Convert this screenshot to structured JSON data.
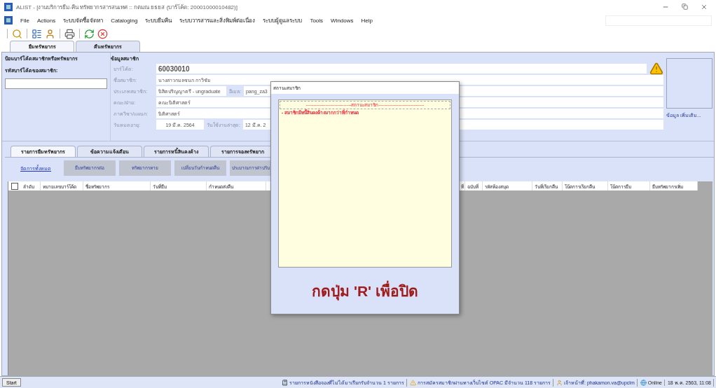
{
  "window": {
    "title": "ALIST - [งานบริการยืม-คืน ทรัพยากรสารสนเทศ :: กตมณ ยธยส (บาร์โค้ด: 20001000010482)]"
  },
  "menu": [
    "File",
    "Actions",
    "ระบบจัดซื้อจัดหา",
    "Cataloging",
    "ระบบยืมคืน",
    "ระบบวารสารและสิ่งพิมพ์ต่อเนื่อง",
    "ระบบผู้ดูแลระบบ",
    "Tools",
    "Windows",
    "Help"
  ],
  "main_tabs": [
    {
      "label": "ยืมทรัพยากร",
      "selected": true
    },
    {
      "label": "คืนทรัพยากร",
      "selected": false
    }
  ],
  "barcode_panel": {
    "title": "ป้อนบาร์โค้ดสมาชิกหรือทรัพยากร",
    "label": "รหัสบาร์โค้ดของสมาชิก:"
  },
  "member_info": {
    "title": "ข้อมูลสมาชิก",
    "rows": [
      {
        "fields": [
          {
            "label": "บาร์โค้ด:",
            "value": "60030010",
            "kind": "large"
          }
        ]
      },
      {
        "fields": [
          {
            "label": "ชื่อสมาชิก:",
            "value": "นางสาวกมลชนก กาวิชัย",
            "kind": "normal"
          }
        ]
      },
      {
        "fields": [
          {
            "label": "ประเภทสมาชิก:",
            "value": "นิสิตปริญญาตรี - ungraduate",
            "kind": "short"
          },
          {
            "label": "อีเมล:",
            "value": "pang_za3",
            "kind": "normal"
          }
        ]
      },
      {
        "fields": [
          {
            "label": "คณะ/ฝ่าย:",
            "value": "คณะนิติศาสตร์",
            "kind": "normal"
          }
        ]
      },
      {
        "fields": [
          {
            "label": "ภาควิชา/แผนก:",
            "value": "นิติศาสตร์",
            "kind": "normal"
          }
        ]
      },
      {
        "fields": [
          {
            "label": "วันหมดอายุ:",
            "value": "19 มี.ค. 2564",
            "kind": "date"
          },
          {
            "label": "วันใช้งานล่าสุด:",
            "value": "12 มี.ค. 2",
            "kind": "normal"
          }
        ]
      }
    ],
    "more_link": "ข้อมูล เพิ่มเติม..."
  },
  "sub_tabs": [
    {
      "label": "รายการยืมทรัพยากร",
      "selected": true
    },
    {
      "label": "ข้อความแจ้งเตือน",
      "selected": false
    },
    {
      "label": "รายการหนี้สินคงค้าง",
      "selected": false
    },
    {
      "label": "รายการจองทรัพยาก",
      "selected": false
    }
  ],
  "manage_link": "จัดการทั้งหมด",
  "action_buttons": [
    "ยืมทรัพยากรต่อ",
    "ทรัพยากรหาย",
    "เปลี่ยนวันกำหนดคืน",
    "ประมาณการค่าปรับ"
  ],
  "table": {
    "select_all_checked": false,
    "columns_left": [
      "ลำดับ",
      "หมายเลขบาร์โค้ด",
      "ชื่อทรัพยากร",
      "วันที่ยืม",
      "กำหนดส่งคืน"
    ],
    "columns_right": [
      "ที่",
      "ฉบับที่",
      "รหัสห้องสมุด",
      "วันที่เรียกคืน",
      "โน้ตการเรียกคืน",
      "โน้ตการยืม",
      "ยืมทรัพยากรเพิ่ม"
    ]
  },
  "dialog": {
    "title": "สถานะสมาชิก",
    "heading": "------------------------------สถานะสมาชิก------------------------------",
    "messages": [
      "- สมาชิกมีหนี้สินคงค้างมากกว่าที่กำหนด"
    ],
    "hint": "กดปุ่ม 'R' เพื่อปิด"
  },
  "status_bar": {
    "start": "Start",
    "items": [
      {
        "kind": "reservation",
        "text": "รายการหนังสือจองที่ไม่ได้มาเรียกรับจำนวน 1 รายการ"
      },
      {
        "kind": "warning",
        "text": "การสมัครสมาชิกผ่านทางเว็บไซต์ OPAC มีจำนวน 118 รายการ"
      },
      {
        "kind": "user",
        "text": "เจ้าหน้าที่: phakamon.va@upclm"
      },
      {
        "kind": "online",
        "text": "Online"
      },
      {
        "kind": "plain",
        "text": "18 พ.ค. 2563, 11:08"
      }
    ]
  }
}
